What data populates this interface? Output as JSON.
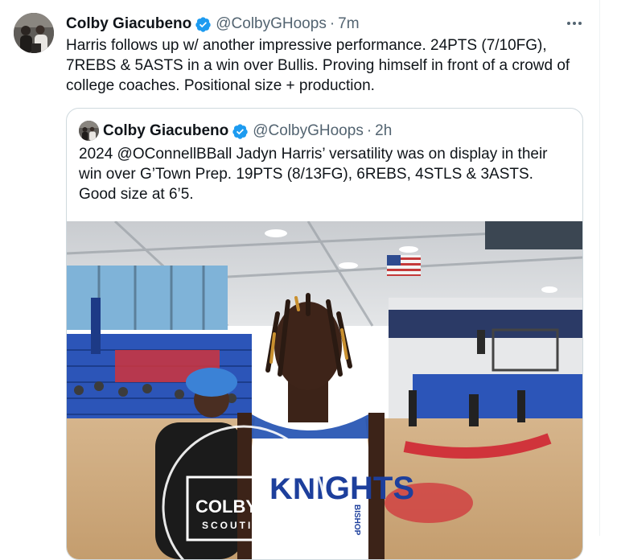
{
  "tweet": {
    "author_name": "Colby Giacubeno",
    "author_handle": "@ColbyGHoops",
    "separator": "·",
    "timestamp": "7m",
    "more_icon": "more-horizontal-icon",
    "text": "Harris follows up w/ another impressive performance. 24PTS (7/10FG), 7REBS & 5ASTS in a win over Bullis. Proving himself in front of a crowd of college coaches. Positional size + production."
  },
  "quoted_tweet": {
    "author_name": "Colby Giacubeno",
    "author_handle": "@ColbyGHoops",
    "separator": "·",
    "timestamp": "2h",
    "text": "2024 @OConnellBBall Jadyn Harris’ versatility was on display in their win over G’Town Prep. 19PTS (8/13FG), 6REBS, 4STLS & 3ASTS. Good size at 6’5.",
    "media": {
      "jersey_text": "KNIGHTS",
      "jersey_side_text": "BISHOP",
      "watermark_line1": "COLBY G",
      "watermark_line2": "SCOUTING"
    }
  },
  "colors": {
    "verified_blue": "#1d9bf0",
    "secondary_text": "#536471",
    "border": "#cfd9de",
    "court_blue": "#2c55b8",
    "court_red": "#d0343b"
  }
}
